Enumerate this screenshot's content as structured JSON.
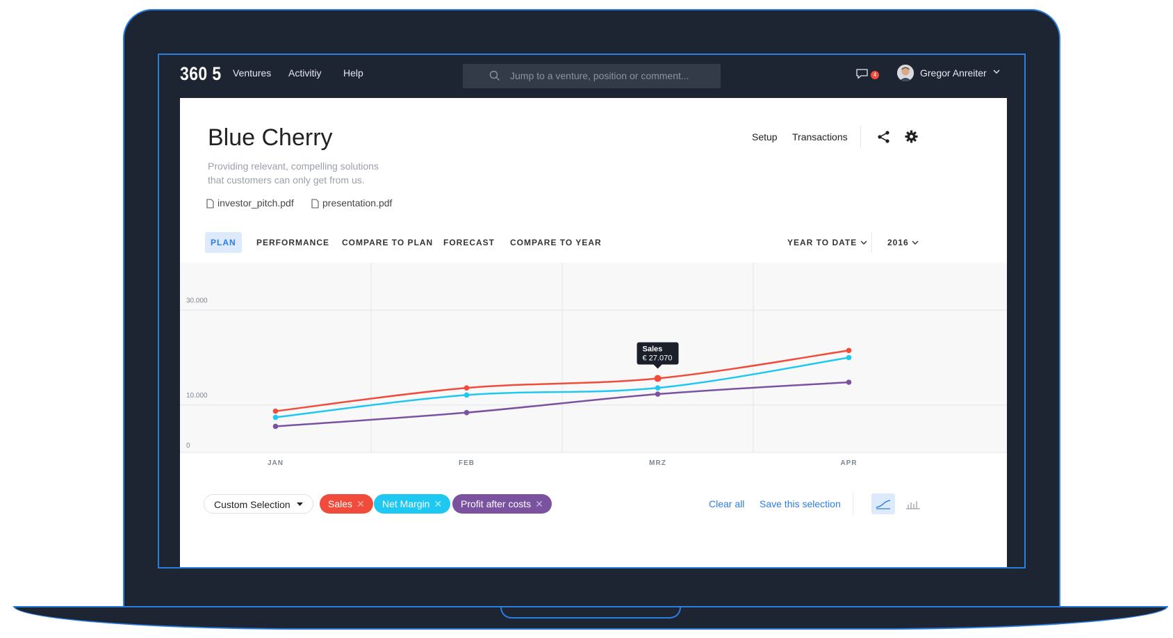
{
  "nav": {
    "logo": "360 5",
    "links": [
      "Ventures",
      "Activitiy",
      "Help"
    ],
    "search_placeholder": "Jump to a venture, position or comment...",
    "notifications_count": "4",
    "user_name": "Gregor Anreiter"
  },
  "venture": {
    "title": "Blue Cherry",
    "description_line1": "Providing relevant, compelling solutions",
    "description_line2": "that customers can only get from us.",
    "files": [
      "investor_pitch.pdf",
      "presentation.pdf"
    ],
    "header_links": [
      "Setup",
      "Transactions"
    ]
  },
  "tabs": [
    "PLAN",
    "PERFORMANCE",
    "COMPARE TO PLAN",
    "FORECAST",
    "COMPARE TO YEAR"
  ],
  "active_tab": "PLAN",
  "filters": {
    "period": "YEAR TO DATE",
    "year": "2016"
  },
  "tooltip": {
    "label": "Sales",
    "value": "€ 27.070"
  },
  "chart_data": {
    "type": "line",
    "categories": [
      "JAN",
      "FEB",
      "MRZ",
      "APR"
    ],
    "y_tick_labels": [
      "0",
      "10.000",
      "30.000"
    ],
    "y_tick_values": [
      0,
      10000,
      30000
    ],
    "ylim": [
      0,
      40000
    ],
    "grid": true,
    "series": [
      {
        "name": "Sales",
        "color": "#f04b3b",
        "values": [
          8700,
          13600,
          15600,
          21500
        ]
      },
      {
        "name": "Net Margin",
        "color": "#1ec8f0",
        "values": [
          7400,
          12100,
          13600,
          20000
        ]
      },
      {
        "name": "Profit after costs",
        "color": "#7a52a0",
        "values": [
          5500,
          8400,
          12300,
          14800
        ]
      }
    ]
  },
  "selection": {
    "dropdown_label": "Custom Selection",
    "chips": [
      {
        "label": "Sales",
        "color": "#f04b3b",
        "x_color": "#fbb3ab"
      },
      {
        "label": "Net Margin",
        "color": "#1ec8f0",
        "x_color": "#b9eefb"
      },
      {
        "label": "Profit after costs",
        "color": "#7a52a0",
        "x_color": "#c9b5df"
      }
    ],
    "clear_all": "Clear all",
    "save": "Save this selection"
  }
}
